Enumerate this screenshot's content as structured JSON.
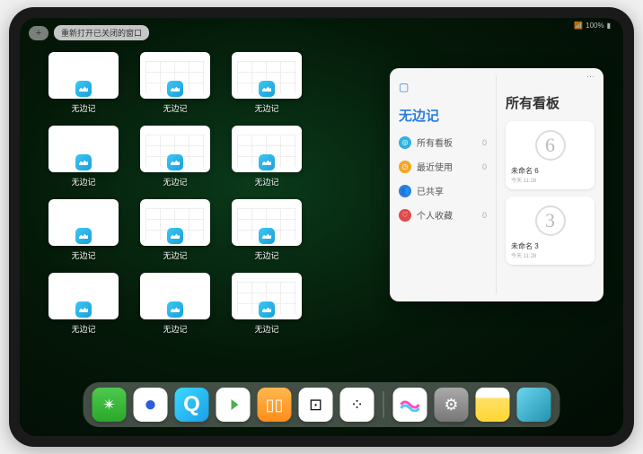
{
  "status": {
    "time": "100%",
    "signal": "📶"
  },
  "topbar": {
    "plus": "+",
    "reopen_label": "重新打开已关闭的窗口"
  },
  "app_windows": {
    "label": "无边记",
    "items": [
      {
        "style": "blank"
      },
      {
        "style": "grid"
      },
      {
        "style": "grid"
      },
      {
        "style": "blank"
      },
      {
        "style": "grid"
      },
      {
        "style": "grid"
      },
      {
        "style": "blank"
      },
      {
        "style": "grid"
      },
      {
        "style": "grid"
      },
      {
        "style": "blank"
      },
      {
        "style": "blank"
      },
      {
        "style": "grid"
      }
    ]
  },
  "panel": {
    "ellipsis": "···",
    "title": "无边记",
    "nav": [
      {
        "icon": "◎",
        "label": "所有看板",
        "count": "0",
        "color": "#2bb2e3"
      },
      {
        "icon": "◷",
        "label": "最近使用",
        "count": "0",
        "color": "#f5a623"
      },
      {
        "icon": "👥",
        "label": "已共享",
        "count": "",
        "color": "#2b7de0"
      },
      {
        "icon": "♡",
        "label": "个人收藏",
        "count": "0",
        "color": "#e24a4a"
      }
    ],
    "right_title": "所有看板",
    "boards": [
      {
        "preview": "6",
        "name": "未命名 6",
        "time": "今天 11:28"
      },
      {
        "preview": "3",
        "name": "未命名 3",
        "time": "今天 11:28"
      }
    ]
  },
  "dock": {
    "left": [
      {
        "name": "wechat-icon",
        "class": "wechat",
        "glyph": "✴"
      },
      {
        "name": "quark-icon",
        "class": "quark",
        "glyph": "●"
      },
      {
        "name": "qqbrowser-icon",
        "class": "qqbrowser",
        "glyph": "Q"
      },
      {
        "name": "play-icon",
        "class": "play",
        "glyph": ""
      },
      {
        "name": "books-icon",
        "class": "books",
        "glyph": "▯▯"
      },
      {
        "name": "dice-icon",
        "class": "dice",
        "glyph": "⊡"
      },
      {
        "name": "game-icon",
        "class": "dots",
        "glyph": "⁘"
      }
    ],
    "right": [
      {
        "name": "freeform-icon",
        "class": "freeform",
        "glyph": "〰"
      },
      {
        "name": "settings-icon",
        "class": "settings",
        "glyph": "⚙"
      },
      {
        "name": "notes-icon",
        "class": "notes",
        "glyph": ""
      },
      {
        "name": "app-library-icon",
        "class": "folder",
        "glyph": ""
      }
    ]
  }
}
